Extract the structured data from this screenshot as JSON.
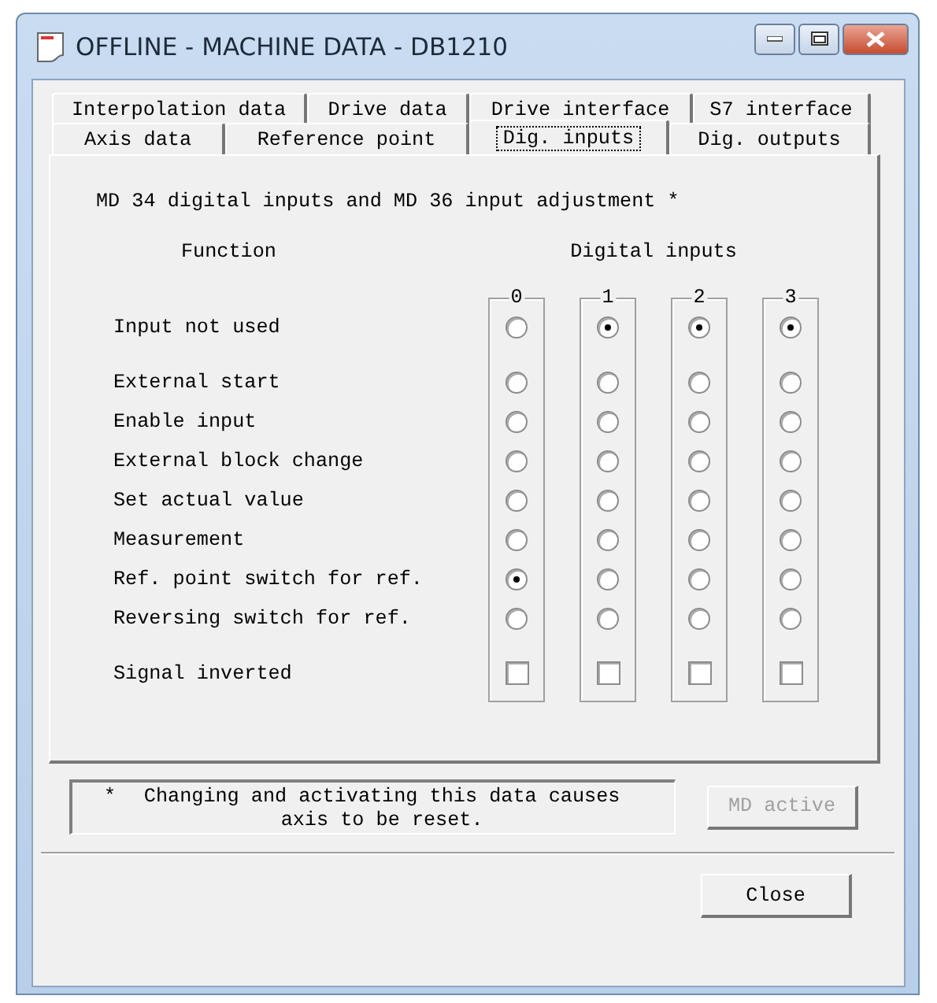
{
  "window": {
    "title": "OFFLINE - MACHINE DATA - DB1210"
  },
  "tab_rows": [
    {
      "tabs": [
        {
          "label": "Interpolation data",
          "selected": false
        },
        {
          "label": "Drive data",
          "selected": false
        },
        {
          "label": "Drive interface",
          "selected": false
        },
        {
          "label": "S7 interface",
          "selected": false
        }
      ]
    },
    {
      "tabs": [
        {
          "label": "Axis data",
          "selected": false
        },
        {
          "label": "Reference point",
          "selected": false
        },
        {
          "label": "Dig. inputs",
          "selected": true
        },
        {
          "label": "Dig. outputs",
          "selected": false
        }
      ]
    }
  ],
  "heading": "MD 34 digital inputs and MD 36 input adjustment *",
  "function_header": "Function",
  "inputs_header": "Digital inputs",
  "inputs": [
    {
      "label": "0"
    },
    {
      "label": "1"
    },
    {
      "label": "2"
    },
    {
      "label": "3"
    }
  ],
  "rows": [
    {
      "label": "Input not used",
      "kind": "radio",
      "cells": [
        {
          "selected": false
        },
        {
          "selected": true
        },
        {
          "selected": true
        },
        {
          "selected": true
        }
      ]
    },
    {
      "label": "External start",
      "kind": "radio",
      "cells": [
        {
          "selected": false
        },
        {
          "selected": false
        },
        {
          "selected": false
        },
        {
          "selected": false
        }
      ]
    },
    {
      "label": "Enable input",
      "kind": "radio",
      "cells": [
        {
          "selected": false
        },
        {
          "selected": false
        },
        {
          "selected": false
        },
        {
          "selected": false
        }
      ]
    },
    {
      "label": "External block change",
      "kind": "radio",
      "cells": [
        {
          "selected": false
        },
        {
          "selected": false
        },
        {
          "selected": false
        },
        {
          "selected": false
        }
      ]
    },
    {
      "label": "Set actual value",
      "kind": "radio",
      "cells": [
        {
          "selected": false
        },
        {
          "selected": false
        },
        {
          "selected": false
        },
        {
          "selected": false
        }
      ]
    },
    {
      "label": "Measurement",
      "kind": "radio",
      "cells": [
        {
          "selected": false
        },
        {
          "selected": false
        },
        {
          "selected": false
        },
        {
          "selected": false
        }
      ]
    },
    {
      "label": "Ref. point switch for ref.",
      "kind": "radio",
      "cells": [
        {
          "selected": true
        },
        {
          "selected": false
        },
        {
          "selected": false
        },
        {
          "selected": false
        }
      ]
    },
    {
      "label": "Reversing switch for ref.",
      "kind": "radio",
      "cells": [
        {
          "selected": false
        },
        {
          "selected": false
        },
        {
          "selected": false
        },
        {
          "selected": false
        }
      ]
    },
    {
      "label": "Signal inverted",
      "kind": "checkbox",
      "cells": [
        {
          "checked": false
        },
        {
          "checked": false
        },
        {
          "checked": false
        },
        {
          "checked": false
        }
      ]
    }
  ],
  "note": {
    "marker": "*",
    "text": "Changing and activating this data causes axis to be reset."
  },
  "md_active_button": {
    "label": "MD active",
    "disabled": true
  },
  "close_button": {
    "label": "Close",
    "disabled": false
  }
}
